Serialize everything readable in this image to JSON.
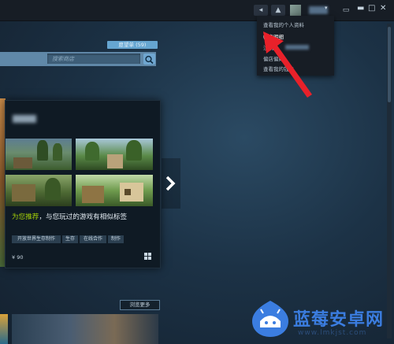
{
  "titlebar": {
    "friends_label": "",
    "username": "",
    "window_controls": [
      "minimize-icon",
      "maximize-icon",
      "close-icon"
    ]
  },
  "account_menu": {
    "items": [
      {
        "label": "查看我的个人资料",
        "highlighted": false
      },
      {
        "label": "帐户明细",
        "highlighted": true
      },
      {
        "label": "注销",
        "highlighted": false
      },
      {
        "label": "偏店偏好",
        "highlighted": false
      },
      {
        "label": "查看我的钱包",
        "highlighted": false
      }
    ]
  },
  "store": {
    "wishlist_button": "愿望单 (59)",
    "search_placeholder": "搜索商店"
  },
  "featured": {
    "recommendation_prefix": "为您推荐",
    "recommendation_text": "，与您玩过的游戏有相似标签",
    "tags": [
      "开放世界生存制作",
      "生存",
      "在线合作",
      "制作"
    ],
    "price": "¥ 90",
    "platform_icon": "windows-icon"
  },
  "browse_more": "浏览更多",
  "watermark": {
    "brand": "蓝莓安卓网",
    "url": "www.lmkjst.com"
  },
  "colors": {
    "accent_green": "#a4d007",
    "button_blue": "#66a6d1",
    "red_arrow": "#e8212a",
    "watermark_blue": "#3b7de0"
  }
}
